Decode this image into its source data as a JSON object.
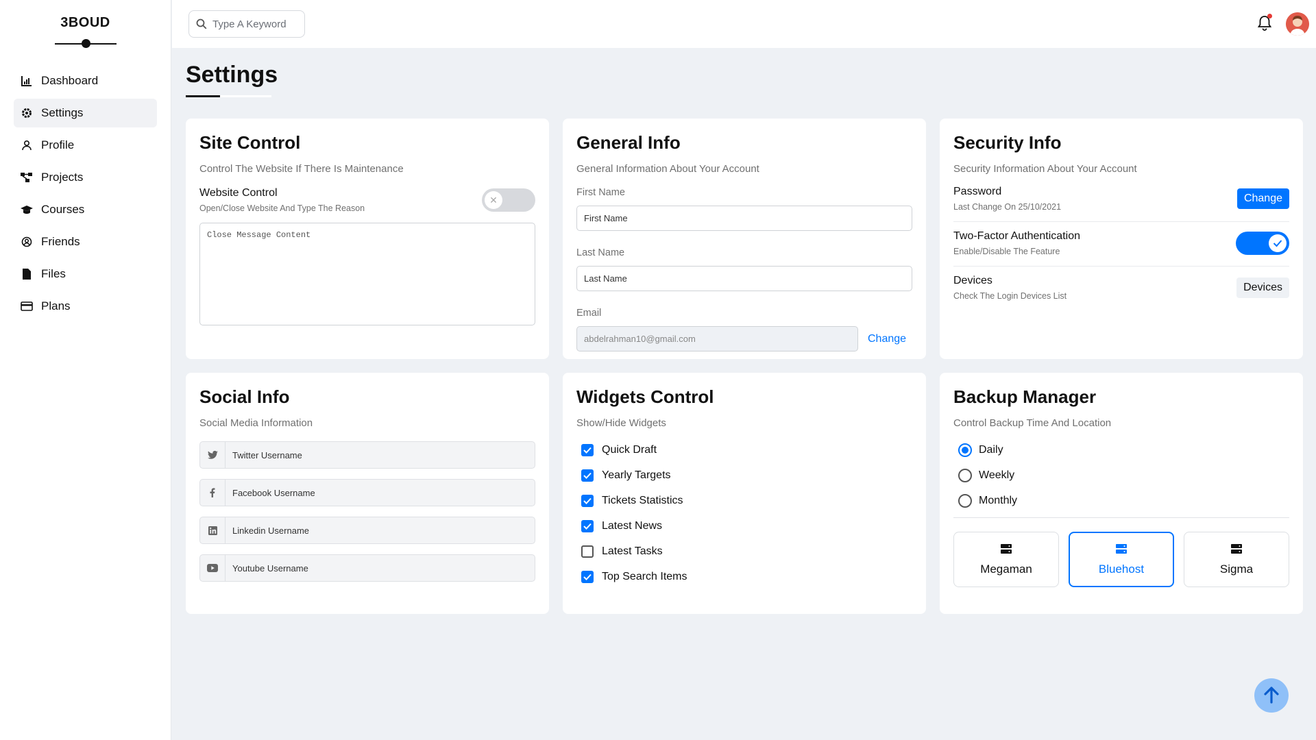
{
  "brand": {
    "name": "3BOUD"
  },
  "sidebar": {
    "items": [
      {
        "label": "Dashboard",
        "icon": "chart-icon"
      },
      {
        "label": "Settings",
        "icon": "gear-icon"
      },
      {
        "label": "Profile",
        "icon": "user-icon"
      },
      {
        "label": "Projects",
        "icon": "diagram-icon"
      },
      {
        "label": "Courses",
        "icon": "graduation-cap-icon"
      },
      {
        "label": "Friends",
        "icon": "user-circle-icon"
      },
      {
        "label": "Files",
        "icon": "file-icon"
      },
      {
        "label": "Plans",
        "icon": "credit-card-icon"
      }
    ],
    "active": "Settings"
  },
  "header": {
    "search_placeholder": "Type A Keyword"
  },
  "page": {
    "title": "Settings"
  },
  "site_control": {
    "title": "Site Control",
    "subtitle": "Control The Website If There Is Maintenance",
    "toggle_label": "Website Control",
    "toggle_sub": "Open/Close Website And Type The Reason",
    "toggle_on": false,
    "textarea_placeholder": "Close Message Content"
  },
  "general_info": {
    "title": "General Info",
    "subtitle": "General Information About Your Account",
    "first_name_label": "First Name",
    "first_name_placeholder": "First Name",
    "last_name_label": "Last Name",
    "last_name_placeholder": "Last Name",
    "email_label": "Email",
    "email_value": "abdelrahman10@gmail.com",
    "email_change": "Change"
  },
  "security_info": {
    "title": "Security Info",
    "subtitle": "Security Information About Your Account",
    "password_label": "Password",
    "password_sub": "Last Change On 25/10/2021",
    "password_button": "Change",
    "twofa_label": "Two-Factor Authentication",
    "twofa_sub": "Enable/Disable The Feature",
    "twofa_on": true,
    "devices_label": "Devices",
    "devices_sub": "Check The Login Devices List",
    "devices_button": "Devices"
  },
  "social_info": {
    "title": "Social Info",
    "subtitle": "Social Media Information",
    "fields": [
      {
        "icon": "twitter-icon",
        "placeholder": "Twitter Username"
      },
      {
        "icon": "facebook-icon",
        "placeholder": "Facebook Username"
      },
      {
        "icon": "linkedin-icon",
        "placeholder": "Linkedin Username"
      },
      {
        "icon": "youtube-icon",
        "placeholder": "Youtube Username"
      }
    ]
  },
  "widgets_control": {
    "title": "Widgets Control",
    "subtitle": "Show/Hide Widgets",
    "items": [
      {
        "label": "Quick Draft",
        "checked": true
      },
      {
        "label": "Yearly Targets",
        "checked": true
      },
      {
        "label": "Tickets Statistics",
        "checked": true
      },
      {
        "label": "Latest News",
        "checked": true
      },
      {
        "label": "Latest Tasks",
        "checked": false
      },
      {
        "label": "Top Search Items",
        "checked": true
      }
    ]
  },
  "backup_manager": {
    "title": "Backup Manager",
    "subtitle": "Control Backup Time And Location",
    "options": [
      {
        "label": "Daily",
        "selected": true
      },
      {
        "label": "Weekly",
        "selected": false
      },
      {
        "label": "Monthly",
        "selected": false
      }
    ],
    "servers": [
      {
        "label": "Megaman",
        "selected": false
      },
      {
        "label": "Bluehost",
        "selected": true
      },
      {
        "label": "Sigma",
        "selected": false
      }
    ]
  },
  "colors": {
    "accent": "#0075ff",
    "background": "#eef1f5",
    "notification_dot": "#e53935"
  }
}
